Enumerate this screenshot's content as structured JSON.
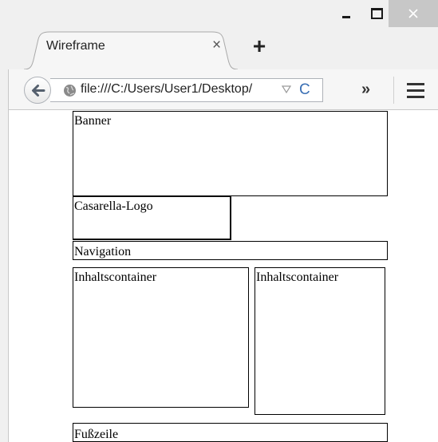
{
  "window": {
    "minimize_icon": "minimize-icon",
    "maximize_icon": "maximize-icon",
    "close_icon": "close-icon"
  },
  "tab": {
    "title": "Wireframe",
    "close_glyph": "×",
    "new_tab_glyph": "+"
  },
  "toolbar": {
    "back_icon": "back-arrow-icon",
    "url": "file:///C:/Users/User1/Desktop/",
    "overflow_glyph": "»",
    "reload_glyph": "C",
    "menu_icon": "hamburger-menu-icon"
  },
  "page": {
    "banner": "Banner",
    "logo": "Casarella-Logo",
    "navigation": "Navigation",
    "content_left": "Inhaltscontainer",
    "content_right": "Inhaltscontainer",
    "footer": "Fußzeile"
  }
}
